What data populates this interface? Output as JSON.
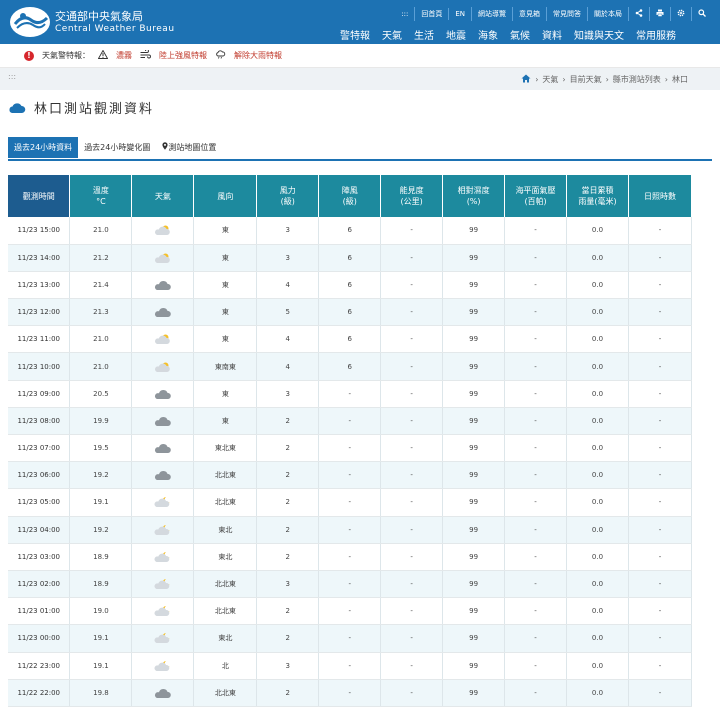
{
  "header": {
    "site_name": "交通部中央氣象局",
    "site_name_en": "Central Weather Bureau",
    "topbar": [
      ":::",
      "回首頁",
      "EN",
      "網站導覽",
      "意見箱",
      "常見問答",
      "關於本局"
    ],
    "nav": [
      "警特報",
      "天氣",
      "生活",
      "地震",
      "海象",
      "氣候",
      "資料",
      "知識與天文",
      "常用服務"
    ]
  },
  "alerts": {
    "label": "天氣警特報：",
    "items": [
      "濃霧",
      "陸上強風特報",
      "解除大雨特報"
    ]
  },
  "breadcrumb": {
    "dots": ":::",
    "items": [
      "天氣",
      "目前天氣",
      "縣市測站列表",
      "林口"
    ]
  },
  "page_title": "林口測站觀測資料",
  "tabs": [
    "過去24小時資料",
    "過去24小時變化圖",
    "測站地圖位置"
  ],
  "table": {
    "headers": [
      [
        "觀測時間",
        ""
      ],
      [
        "溫度",
        "°C"
      ],
      [
        "天氣",
        ""
      ],
      [
        "風向",
        ""
      ],
      [
        "風力",
        "(級)"
      ],
      [
        "陣風",
        "(級)"
      ],
      [
        "能見度",
        "(公里)"
      ],
      [
        "相對濕度",
        "(%)"
      ],
      [
        "海平面氣壓",
        "(百帕)"
      ],
      [
        "當日累積",
        "雨量(毫米)"
      ],
      [
        "日照時數",
        ""
      ]
    ],
    "rows": [
      {
        "time": "11/23 15:00",
        "temp": "21.0",
        "weather": "partly-cloudy-day-icon",
        "dir": "東",
        "force": "3",
        "gust": "6",
        "vis": "-",
        "rh": "99",
        "pres": "-",
        "rain": "0.0",
        "sun": "-"
      },
      {
        "time": "11/23 14:00",
        "temp": "21.2",
        "weather": "partly-cloudy-day-icon",
        "dir": "東",
        "force": "3",
        "gust": "6",
        "vis": "-",
        "rh": "99",
        "pres": "-",
        "rain": "0.0",
        "sun": "-"
      },
      {
        "time": "11/23 13:00",
        "temp": "21.4",
        "weather": "cloudy-icon",
        "dir": "東",
        "force": "4",
        "gust": "6",
        "vis": "-",
        "rh": "99",
        "pres": "-",
        "rain": "0.0",
        "sun": "-"
      },
      {
        "time": "11/23 12:00",
        "temp": "21.3",
        "weather": "cloudy-icon",
        "dir": "東",
        "force": "5",
        "gust": "6",
        "vis": "-",
        "rh": "99",
        "pres": "-",
        "rain": "0.0",
        "sun": "-"
      },
      {
        "time": "11/23 11:00",
        "temp": "21.0",
        "weather": "partly-cloudy-day-icon",
        "dir": "東",
        "force": "4",
        "gust": "6",
        "vis": "-",
        "rh": "99",
        "pres": "-",
        "rain": "0.0",
        "sun": "-"
      },
      {
        "time": "11/23 10:00",
        "temp": "21.0",
        "weather": "partly-cloudy-day-icon",
        "dir": "東南東",
        "force": "4",
        "gust": "6",
        "vis": "-",
        "rh": "99",
        "pres": "-",
        "rain": "0.0",
        "sun": "-"
      },
      {
        "time": "11/23 09:00",
        "temp": "20.5",
        "weather": "cloudy-icon",
        "dir": "東",
        "force": "3",
        "gust": "-",
        "vis": "-",
        "rh": "99",
        "pres": "-",
        "rain": "0.0",
        "sun": "-"
      },
      {
        "time": "11/23 08:00",
        "temp": "19.9",
        "weather": "cloudy-icon",
        "dir": "東",
        "force": "2",
        "gust": "-",
        "vis": "-",
        "rh": "99",
        "pres": "-",
        "rain": "0.0",
        "sun": "-"
      },
      {
        "time": "11/23 07:00",
        "temp": "19.5",
        "weather": "cloudy-icon",
        "dir": "東北東",
        "force": "2",
        "gust": "-",
        "vis": "-",
        "rh": "99",
        "pres": "-",
        "rain": "0.0",
        "sun": "-"
      },
      {
        "time": "11/23 06:00",
        "temp": "19.2",
        "weather": "cloudy-icon",
        "dir": "北北東",
        "force": "2",
        "gust": "-",
        "vis": "-",
        "rh": "99",
        "pres": "-",
        "rain": "0.0",
        "sun": "-"
      },
      {
        "time": "11/23 05:00",
        "temp": "19.1",
        "weather": "partly-cloudy-night-icon",
        "dir": "北北東",
        "force": "2",
        "gust": "-",
        "vis": "-",
        "rh": "99",
        "pres": "-",
        "rain": "0.0",
        "sun": "-"
      },
      {
        "time": "11/23 04:00",
        "temp": "19.2",
        "weather": "partly-cloudy-night-icon",
        "dir": "東北",
        "force": "2",
        "gust": "-",
        "vis": "-",
        "rh": "99",
        "pres": "-",
        "rain": "0.0",
        "sun": "-"
      },
      {
        "time": "11/23 03:00",
        "temp": "18.9",
        "weather": "partly-cloudy-night-icon",
        "dir": "東北",
        "force": "2",
        "gust": "-",
        "vis": "-",
        "rh": "99",
        "pres": "-",
        "rain": "0.0",
        "sun": "-"
      },
      {
        "time": "11/23 02:00",
        "temp": "18.9",
        "weather": "partly-cloudy-night-icon",
        "dir": "北北東",
        "force": "3",
        "gust": "-",
        "vis": "-",
        "rh": "99",
        "pres": "-",
        "rain": "0.0",
        "sun": "-"
      },
      {
        "time": "11/23 01:00",
        "temp": "19.0",
        "weather": "partly-cloudy-night-icon",
        "dir": "北北東",
        "force": "2",
        "gust": "-",
        "vis": "-",
        "rh": "99",
        "pres": "-",
        "rain": "0.0",
        "sun": "-"
      },
      {
        "time": "11/23 00:00",
        "temp": "19.1",
        "weather": "partly-cloudy-night-icon",
        "dir": "東北",
        "force": "2",
        "gust": "-",
        "vis": "-",
        "rh": "99",
        "pres": "-",
        "rain": "0.0",
        "sun": "-"
      },
      {
        "time": "11/22 23:00",
        "temp": "19.1",
        "weather": "partly-cloudy-night-icon",
        "dir": "北",
        "force": "3",
        "gust": "-",
        "vis": "-",
        "rh": "99",
        "pres": "-",
        "rain": "0.0",
        "sun": "-"
      },
      {
        "time": "11/22 22:00",
        "temp": "19.8",
        "weather": "cloudy-icon",
        "dir": "北北東",
        "force": "2",
        "gust": "-",
        "vis": "-",
        "rh": "99",
        "pres": "-",
        "rain": "0.0",
        "sun": "-"
      }
    ]
  },
  "colors": {
    "header_bg": "#1d72b3",
    "table_header": "#1d8a9e",
    "table_header_first": "#1d5c8f",
    "row_stripe": "#eef7fa",
    "alert_red": "#d6262c"
  }
}
